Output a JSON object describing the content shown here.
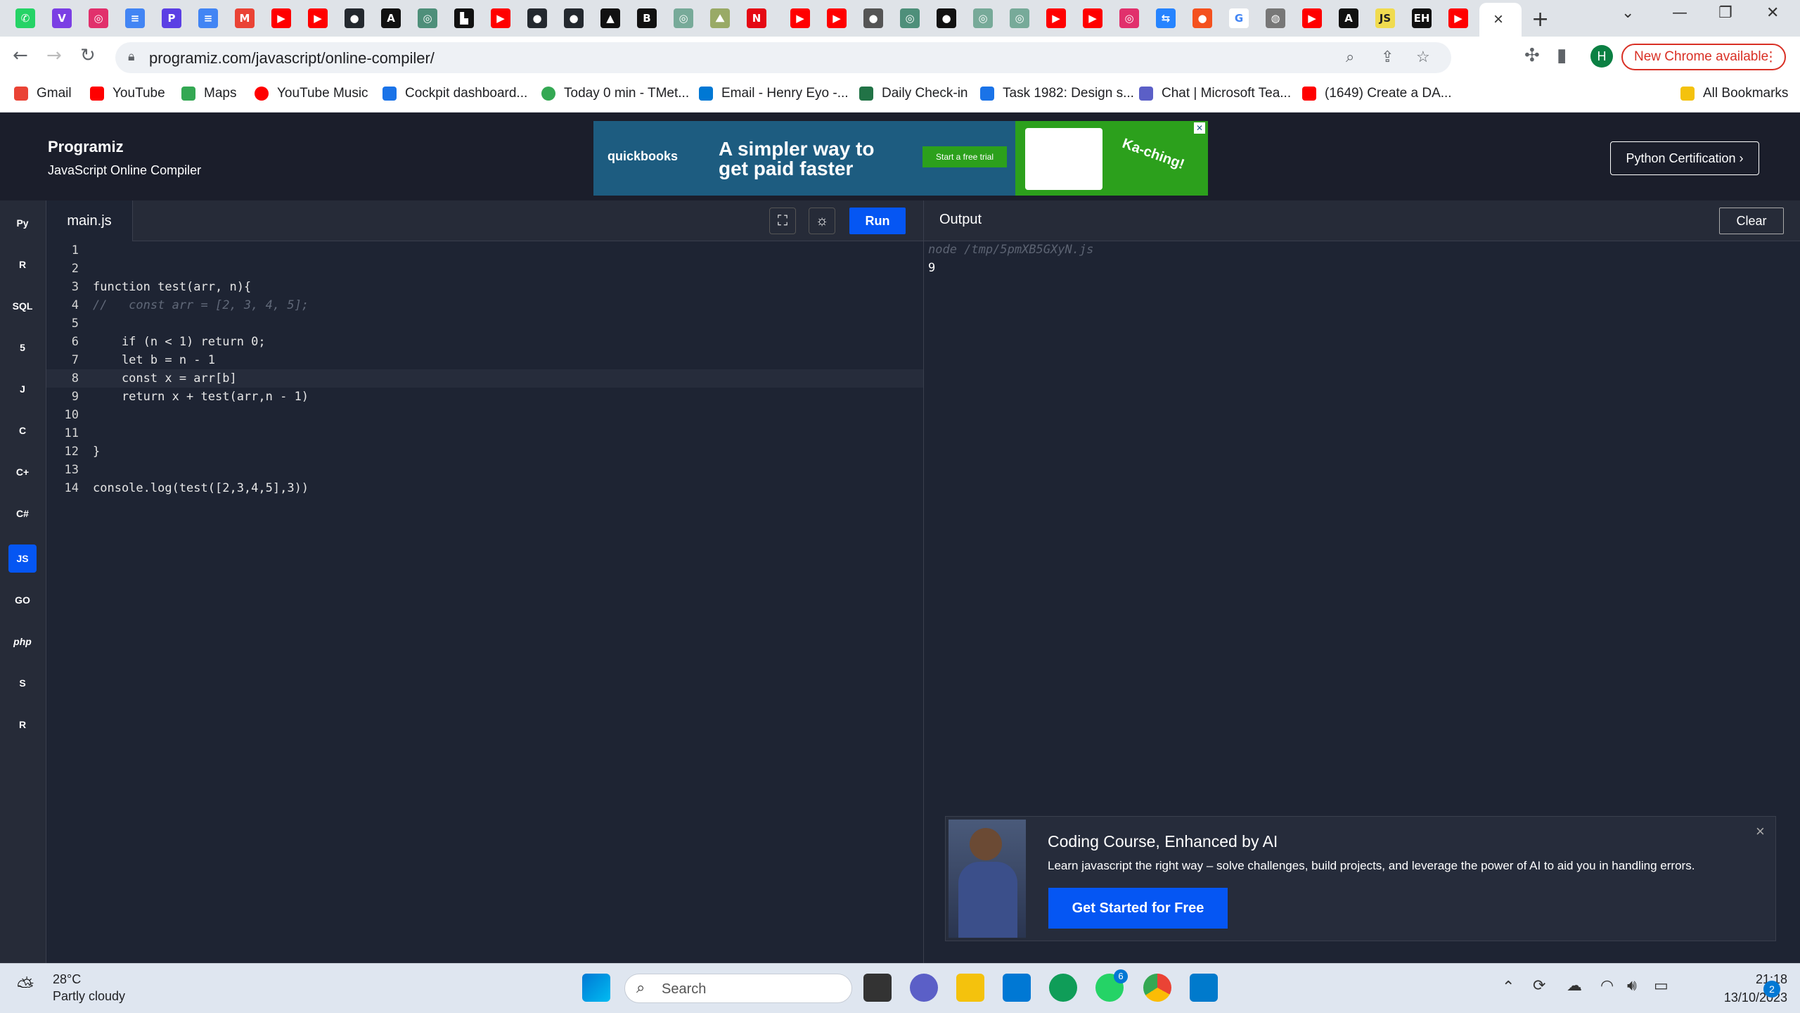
{
  "browser": {
    "tab_close": "×",
    "new_tab": "+",
    "url": "programiz.com/javascript/online-compiler/",
    "avatar_initial": "H",
    "update_label": "New Chrome available",
    "bookmarks": [
      {
        "label": "Gmail",
        "color": "#ea4335"
      },
      {
        "label": "YouTube",
        "color": "#ff0000"
      },
      {
        "label": "Maps",
        "color": "#34a853"
      },
      {
        "label": "YouTube Music",
        "color": "#ff0000"
      },
      {
        "label": "Cockpit dashboard...",
        "color": "#1a73e8"
      },
      {
        "label": "Today 0 min - TMet...",
        "color": "#34a853"
      },
      {
        "label": "Email - Henry Eyo -...",
        "color": "#0078d4"
      },
      {
        "label": "Daily Check-in",
        "color": "#217346"
      },
      {
        "label": "Task 1982: Design s...",
        "color": "#1a73e8"
      },
      {
        "label": "Chat | Microsoft Tea...",
        "color": "#5b5fc7"
      },
      {
        "label": "(1649) Create a DA...",
        "color": "#ff0000"
      }
    ],
    "all_bookmarks": "All Bookmarks"
  },
  "site": {
    "logo": "Programiz",
    "subtitle": "JavaScript Online Compiler",
    "ad": {
      "brand": "quickbooks",
      "headline": "A simpler way to get paid faster",
      "cta": "Start a free trial",
      "tagline": "Ka-ching!"
    },
    "cert_button": "Python Certification ›"
  },
  "editor": {
    "file_tab": "main.js",
    "run_label": "Run",
    "lines": [
      {
        "n": "1",
        "code": ""
      },
      {
        "n": "2",
        "code": ""
      },
      {
        "n": "3",
        "code": "function test(arr, n){"
      },
      {
        "n": "4",
        "code": "//   const arr = [2, 3, 4, 5];"
      },
      {
        "n": "5",
        "code": ""
      },
      {
        "n": "6",
        "code": "    if (n < 1) return 0;"
      },
      {
        "n": "7",
        "code": "    let b = n - 1"
      },
      {
        "n": "8",
        "code": "    const x = arr[b]"
      },
      {
        "n": "9",
        "code": "    return x + test(arr,n - 1)"
      },
      {
        "n": "10",
        "code": ""
      },
      {
        "n": "11",
        "code": ""
      },
      {
        "n": "12",
        "code": "}"
      },
      {
        "n": "13",
        "code": ""
      },
      {
        "n": "14",
        "code": "console.log(test([2,3,4,5],3))"
      }
    ],
    "current_line": 8
  },
  "output": {
    "title": "Output",
    "clear_label": "Clear",
    "command": "node /tmp/5pmXB5GXyN.js",
    "result": "9"
  },
  "languages": [
    {
      "name": "python",
      "label": "Py"
    },
    {
      "name": "r",
      "label": "R"
    },
    {
      "name": "sql",
      "label": "SQL"
    },
    {
      "name": "html",
      "label": "5"
    },
    {
      "name": "java",
      "label": "J"
    },
    {
      "name": "c",
      "label": "C"
    },
    {
      "name": "cpp",
      "label": "C+"
    },
    {
      "name": "csharp",
      "label": "C#"
    },
    {
      "name": "javascript",
      "label": "JS"
    },
    {
      "name": "go",
      "label": "GO"
    },
    {
      "name": "php",
      "label": "php"
    },
    {
      "name": "swift",
      "label": "S"
    },
    {
      "name": "rust",
      "label": "R"
    }
  ],
  "promo": {
    "title": "Coding Course, Enhanced by AI",
    "description": "Learn javascript the right way – solve challenges, build projects, and leverage the power of AI to aid you in handling errors.",
    "cta": "Get Started for Free",
    "close": "×"
  },
  "taskbar": {
    "temperature": "28°C",
    "weather": "Partly cloudy",
    "search_placeholder": "Search",
    "time": "21:18",
    "date": "13/10/2023",
    "notification_count": "2",
    "whatsapp_badge": "6"
  },
  "colors": {
    "accent": "#0556f3",
    "editor_bg": "#1e2433",
    "chrome_update": "#d93025"
  }
}
